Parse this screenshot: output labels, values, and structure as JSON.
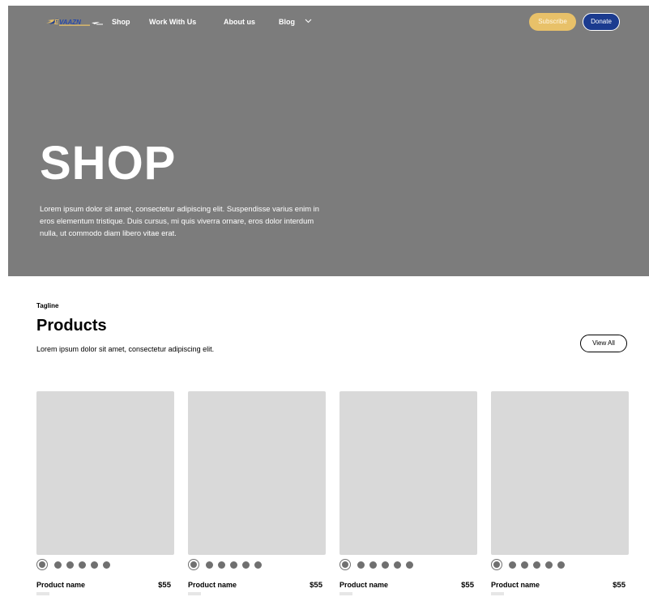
{
  "colors": {
    "hero_bg": "#7c7c7c",
    "subscribe_bg": "#e8c169",
    "donate_bg": "#1b3b8f",
    "placeholder": "#d9d9d9",
    "swatch": "#707070"
  },
  "nav": {
    "logo_icon": "brand-logo",
    "links": [
      "Shop",
      "Work With Us",
      "About us",
      "Blog"
    ],
    "blog_dropdown_icon": "chevron-down-icon",
    "subscribe_label": "Subscribe",
    "donate_label": "Donate"
  },
  "hero": {
    "title": "SHOP",
    "description": "Lorem ipsum dolor sit amet, consectetur adipiscing elit. Suspendisse varius enim in eros elementum tristique. Duis cursus, mi quis viverra ornare, eros dolor interdum nulla, ut commodo diam libero vitae erat."
  },
  "products": {
    "tagline": "Tagline",
    "heading": "Products",
    "description": "Lorem ipsum dolor sit amet, consectetur adipiscing elit.",
    "view_all_label": "View All",
    "items": [
      {
        "name": "Product name",
        "price": "$55"
      },
      {
        "name": "Product name",
        "price": "$55"
      },
      {
        "name": "Product name",
        "price": "$55"
      },
      {
        "name": "Product name",
        "price": "$55"
      }
    ]
  }
}
